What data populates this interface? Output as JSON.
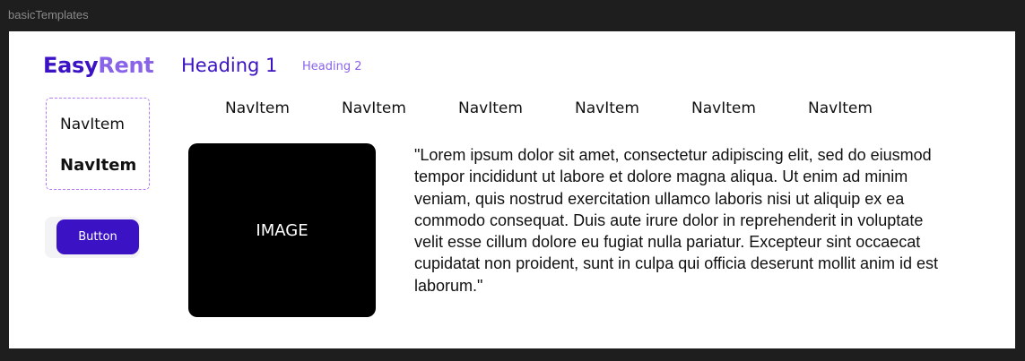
{
  "window": {
    "title": "basicTemplates"
  },
  "brand": {
    "part1": "Easy",
    "part2": "Rent"
  },
  "headings": {
    "h1": "Heading 1",
    "h2": "Heading 2"
  },
  "side_nav": {
    "items": [
      "NavItem",
      "NavItem"
    ]
  },
  "button": {
    "label": "Button"
  },
  "top_nav": {
    "items": [
      "NavItem",
      "NavItem",
      "NavItem",
      "NavItem",
      "NavItem",
      "NavItem"
    ]
  },
  "image_placeholder": {
    "label": "IMAGE"
  },
  "content": {
    "paragraph": "\"Lorem ipsum dolor sit amet, consectetur adipiscing elit, sed do eiusmod tempor incididunt ut labore et dolore magna aliqua. Ut enim ad minim veniam, quis nostrud exercitation ullamco laboris nisi ut aliquip ex ea commodo consequat. Duis aute irure dolor in reprehenderit in voluptate velit esse cillum dolore eu fugiat nulla pariatur. Excepteur sint occaecat cupidatat non proident, sunt in culpa qui officia deserunt mollit anim id est laborum.\""
  },
  "colors": {
    "primary": "#3b12c4",
    "secondary": "#8a64e8",
    "dashed_border": "#b57cf2",
    "canvas_bg": "#1e1e1e",
    "frame_bg": "#ffffff"
  }
}
